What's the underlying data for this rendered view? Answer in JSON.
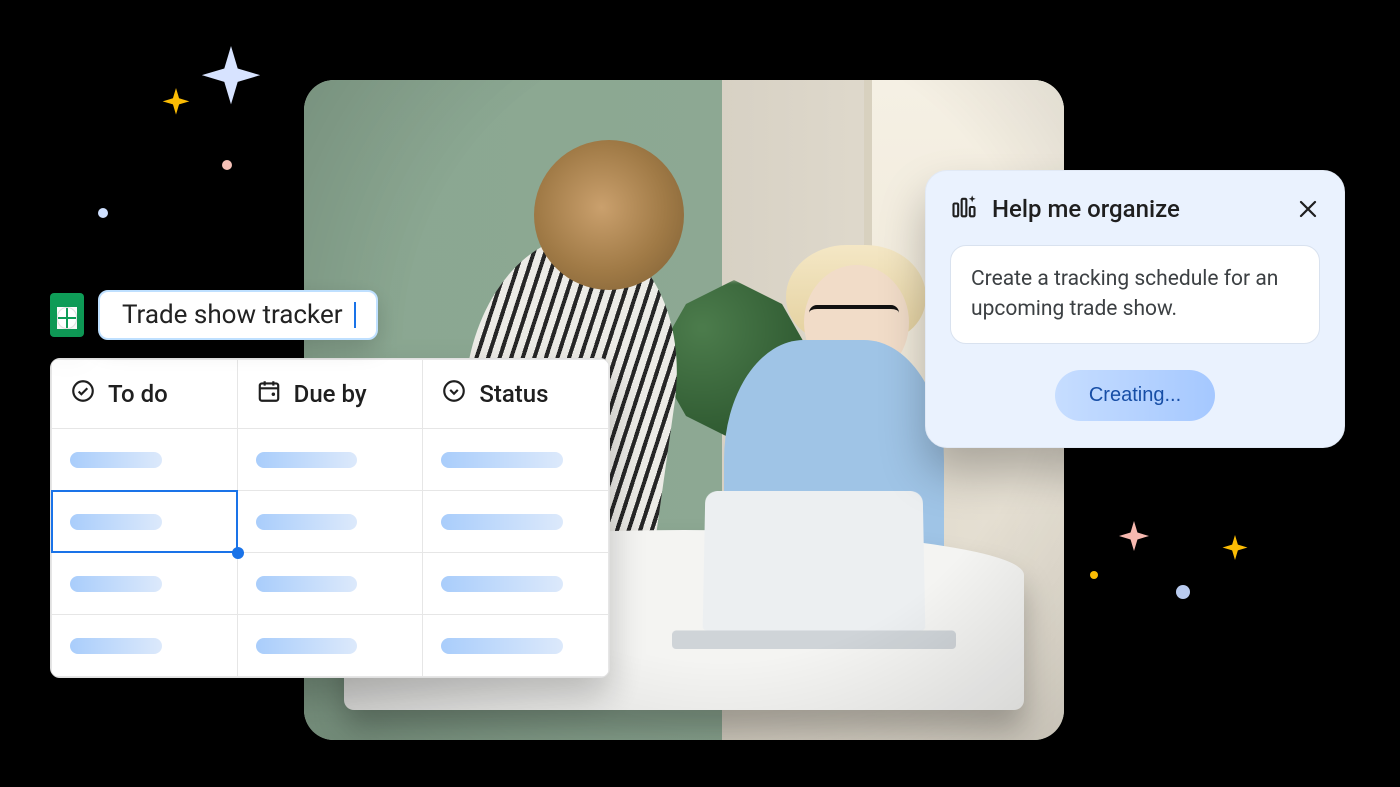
{
  "doc": {
    "title": "Trade show tracker"
  },
  "sheet": {
    "columns": [
      {
        "icon": "check-circle-icon",
        "label": "To do"
      },
      {
        "icon": "calendar-icon",
        "label": "Due by"
      },
      {
        "icon": "status-icon",
        "label": "Status"
      }
    ],
    "row_count": 4,
    "selected_cell": {
      "row": 1,
      "col": 0
    }
  },
  "panel": {
    "title": "Help me organize",
    "prompt": "Create a tracking schedule for an upcoming trade show.",
    "action_label": "Creating..."
  }
}
